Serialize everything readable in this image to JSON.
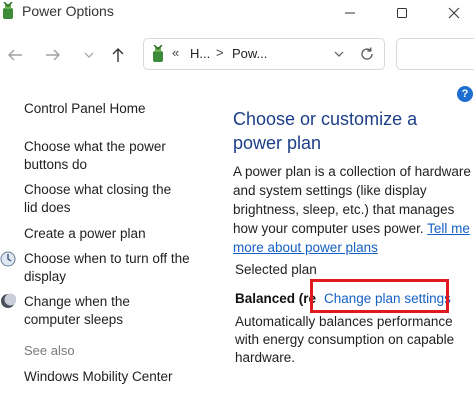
{
  "window": {
    "title": "Power Options",
    "icon": "power-options-icon",
    "controls": [
      "minimize-icon",
      "maximize-icon",
      "close-icon"
    ]
  },
  "nav": {
    "back_icon": "back-arrow-icon",
    "forward_icon": "forward-arrow-icon",
    "recent_icon": "chevron-down-icon",
    "up_icon": "up-arrow-icon",
    "address": {
      "overflow": "«",
      "segments": [
        "H...",
        "Pow..."
      ],
      "separator": ">"
    },
    "refresh_icon": "refresh-icon",
    "help_label": "?"
  },
  "sidebar": {
    "home": "Control Panel Home",
    "items": [
      {
        "label": "Choose what the power buttons do",
        "icon": ""
      },
      {
        "label": "Choose what closing the lid does",
        "icon": ""
      },
      {
        "label": "Create a power plan",
        "icon": ""
      },
      {
        "label": "Choose when to turn off the display",
        "icon": "display-clock-icon"
      },
      {
        "label": "Change when the computer sleeps",
        "icon": "moon-icon"
      }
    ],
    "see_also": "See also",
    "see_also_items": [
      "Windows Mobility Center"
    ]
  },
  "main": {
    "title": "Choose or customize a power plan",
    "description": "A power plan is a collection of hardware and system settings (like display brightness, sleep, etc.) that manages how your computer uses power.",
    "tell_me_more": "Tell me more about power plans",
    "selected_plan_label": "Selected plan",
    "plan_name": "Balanced (re",
    "change_plan_link": "Change plan settings",
    "plan_description": "Automatically balances performance with energy consumption on capable hardware."
  },
  "colors": {
    "title_blue": "#1c3f87",
    "link_blue": "#1560c6",
    "highlight_red": "#e0191e"
  }
}
